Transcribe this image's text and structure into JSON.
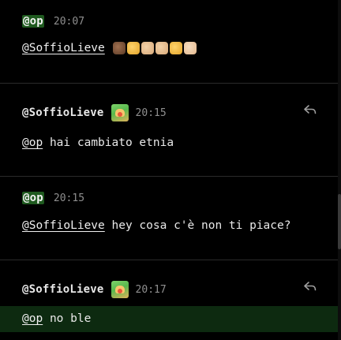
{
  "messages": [
    {
      "author": "@op",
      "is_op": true,
      "time": "20:07",
      "mention": "@SoffioLieve",
      "text": "",
      "emojis": [
        "dark-hand-emoji",
        "gold-hand-emoji",
        "ok-hand-emoji",
        "pinch-hand-emoji",
        "victory-hand-emoji",
        "thumbs-up-emoji"
      ]
    },
    {
      "author": "@SoffioLieve",
      "is_op": false,
      "time": "20:15",
      "mention": "@op",
      "text": "hai cambiato etnia",
      "has_reply": true
    },
    {
      "author": "@op",
      "is_op": true,
      "time": "20:15",
      "mention": "@SoffioLieve",
      "text": "hey cosa c'è non ti piace?"
    },
    {
      "author": "@SoffioLieve",
      "is_op": false,
      "time": "20:17",
      "mention": "@op",
      "text": "no ble",
      "has_reply": true,
      "highlighted": true
    }
  ],
  "colors": {
    "background": "#000000",
    "op_badge": "#1f5a1f",
    "highlight": "#0d2a10",
    "divider": "#2a2a2a",
    "timestamp": "#8f8f8f"
  }
}
